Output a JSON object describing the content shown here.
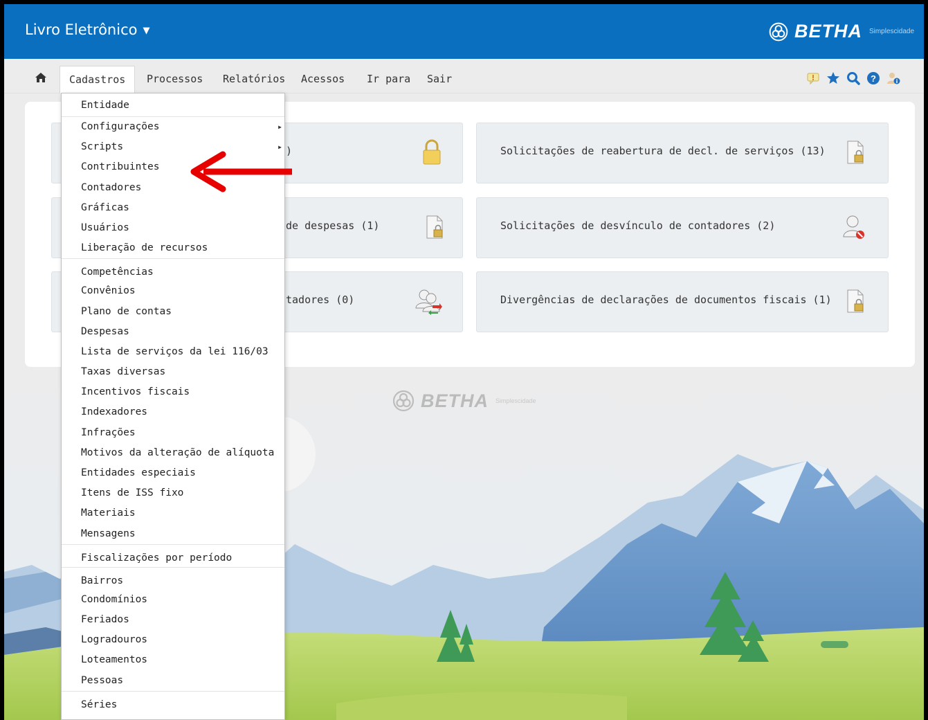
{
  "header": {
    "app_title": "Livro Eletrônico",
    "brand_name": "BETHA",
    "brand_sub_a": "Simples",
    "brand_sub_b": "cidade"
  },
  "nav": {
    "items": [
      "Cadastros",
      "Processos",
      "Relatórios",
      "Acessos",
      "Ir para",
      "Sair"
    ],
    "active": "Cadastros",
    "tools": [
      "notice-icon",
      "star-icon",
      "search-icon",
      "help-icon",
      "user-info-icon"
    ]
  },
  "tiles": [
    {
      "text": ")",
      "icon": "lock-icon"
    },
    {
      "text": "Solicitações de reabertura de decl. de serviços (13)",
      "icon": "document-lock-icon"
    },
    {
      "text": "de despesas (1)",
      "icon": "document-lock-icon"
    },
    {
      "text": "Solicitações de desvínculo de contadores (2)",
      "icon": "user-remove-icon"
    },
    {
      "text": "tadores (0)",
      "icon": "users-transfer-icon"
    },
    {
      "text": "Divergências de declarações de documentos fiscais (1)",
      "icon": "document-lock-icon"
    }
  ],
  "watermark": {
    "name": "BETHA",
    "sub_a": "Simples",
    "sub_b": "cidade"
  },
  "menu": {
    "items": [
      "Entidade",
      "Configurações",
      "Scripts",
      "Contribuintes",
      "Contadores",
      "Gráficas",
      "Usuários",
      "Liberação de recursos",
      "Competências",
      "Convênios",
      "Plano de contas",
      "Despesas",
      "Lista de serviços da lei 116/03",
      "Taxas diversas",
      "Incentivos fiscais",
      "Indexadores",
      "Infrações",
      "Motivos da alteração de alíquota",
      "Entidades especiais",
      "Itens de ISS fixo",
      "Materiais",
      "Mensagens",
      "Fiscalizações por período",
      "Bairros",
      "Condomínios",
      "Feriados",
      "Logradouros",
      "Loteamentos",
      "Pessoas",
      "Séries"
    ],
    "highlighted": "Contribuintes"
  },
  "colors": {
    "header_bg": "#0a6fbe",
    "annotation_arrow": "#e60000"
  }
}
